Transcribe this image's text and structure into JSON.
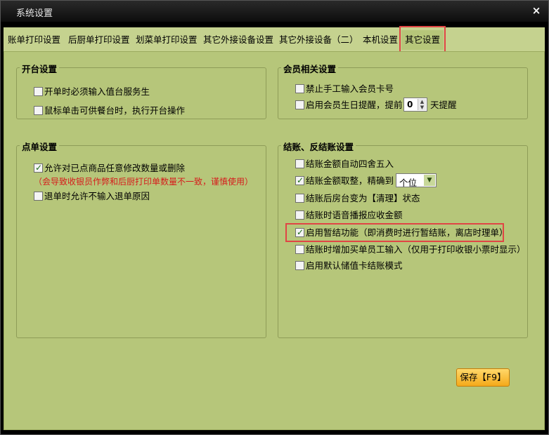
{
  "window": {
    "title": "系统设置",
    "close_label": "×"
  },
  "tabs": [
    {
      "label": "账单打印设置"
    },
    {
      "label": "后厨单打印设置"
    },
    {
      "label": "划菜单打印设置"
    },
    {
      "label": "其它外接设备设置"
    },
    {
      "label": "其它外接设备（二）"
    },
    {
      "label": "本机设置"
    },
    {
      "label": "其它设置"
    }
  ],
  "active_tab": "其它设置",
  "groups": {
    "open_table": {
      "title": "开台设置",
      "options": [
        {
          "label": "开单时必须输入值台服务生",
          "checked": false
        },
        {
          "label": "鼠标单击可供餐台时，执行开台操作",
          "checked": false
        }
      ]
    },
    "member": {
      "title": "会员相关设置",
      "options": [
        {
          "label": "禁止手工输入会员卡号",
          "checked": false
        },
        {
          "label": "启用会员生日提醒，提前",
          "checked": false
        }
      ],
      "birthday_days": "0",
      "birthday_suffix": "天提醒"
    },
    "order": {
      "title": "点单设置",
      "options": [
        {
          "label": "允许对已点商品任意修改数量或删除",
          "checked": true
        },
        {
          "label": "退单时允许不输入退单原因",
          "checked": false
        }
      ],
      "warning": "（会导致收银员作弊和后厨打印单数量不一致，谨慎使用）"
    },
    "checkout": {
      "title": "结账、反结账设置",
      "options": [
        {
          "label": "结账金额自动四舍五入",
          "checked": false
        },
        {
          "label": "结账金额取整，精确到",
          "checked": true
        },
        {
          "label": "结账后房台变为【清理】状态",
          "checked": false
        },
        {
          "label": "结账时语音播报应收金额",
          "checked": false
        },
        {
          "label": "启用暂结功能（即消费时进行暂结账，离店时理单）",
          "checked": true
        },
        {
          "label": "结账时增加买单员工输入（仅用于打印收银小票时显示）",
          "checked": false
        },
        {
          "label": "启用默认储值卡结账模式",
          "checked": false
        }
      ],
      "precision_value": "个位"
    }
  },
  "save_label": "保存【F9】",
  "colors": {
    "panel": "#b6c67a",
    "highlight": "#e04545",
    "warning": "#d61c1c"
  }
}
